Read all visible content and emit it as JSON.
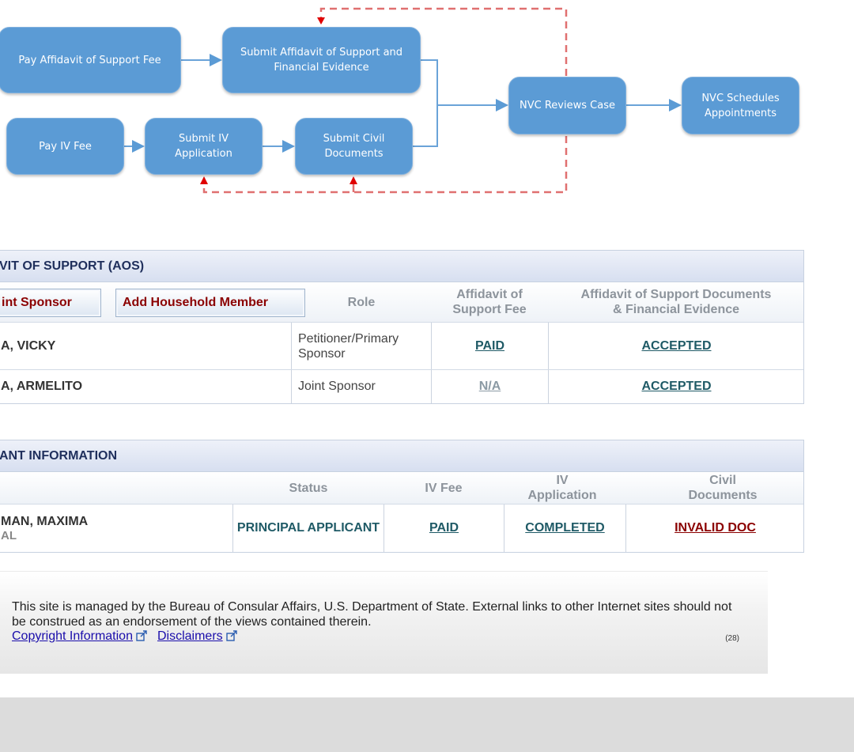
{
  "flow": {
    "nodes": [
      {
        "id": "pay-aos-fee",
        "label": "Pay Affidavit of Support Fee"
      },
      {
        "id": "submit-aos",
        "label": "Submit Affidavit of Support and Financial Evidence"
      },
      {
        "id": "pay-iv-fee",
        "label": "Pay IV Fee"
      },
      {
        "id": "submit-iv",
        "label": "Submit IV Application"
      },
      {
        "id": "submit-civil",
        "label": "Submit Civil Documents"
      },
      {
        "id": "nvc-reviews",
        "label": "NVC Reviews Case"
      },
      {
        "id": "nvc-schedules",
        "label": "NVC Schedules Appointments"
      }
    ]
  },
  "aos": {
    "title": "VIT OF SUPPORT (AOS)",
    "buttons": {
      "joint_sponsor": "int Sponsor",
      "add_household": "Add Household Member"
    },
    "columns": {
      "role": "Role",
      "fee": "Affidavit of Support Fee",
      "docs": "Affidavit of Support Documents & Financial Evidence"
    },
    "rows": [
      {
        "name": "A, VICKY",
        "role": "Petitioner/Primary Sponsor",
        "fee": "PAID",
        "docs": "ACCEPTED"
      },
      {
        "name": "A, ARMELITO",
        "role": "Joint Sponsor",
        "fee": "N/A",
        "docs": "ACCEPTED"
      }
    ]
  },
  "applicant": {
    "title": "ANT INFORMATION",
    "columns": {
      "status": "Status",
      "iv_fee": "IV Fee",
      "iv_app": "IV Application",
      "civil": "Civil Documents"
    },
    "rows": [
      {
        "name": "MAN, MAXIMA",
        "sub": "AL",
        "status": "PRINCIPAL APPLICANT",
        "iv_fee": "PAID",
        "iv_app": "COMPLETED",
        "civil": "INVALID DOC"
      }
    ]
  },
  "footer": {
    "text": "This site is managed by the Bureau of Consular Affairs, U.S. Department of State. External links to other Internet sites should not be construed as an endorsement of the views contained therein.",
    "copyright": "Copyright Information",
    "disclaimers": "Disclaimers",
    "count": "(28)"
  },
  "colors": {
    "node": "#5b9bd5",
    "arrow": "#5b9bd5",
    "loop": "#e06060",
    "loop_arrow": "#e00000",
    "status_link": "#1f5a66",
    "error": "#8b0000"
  }
}
